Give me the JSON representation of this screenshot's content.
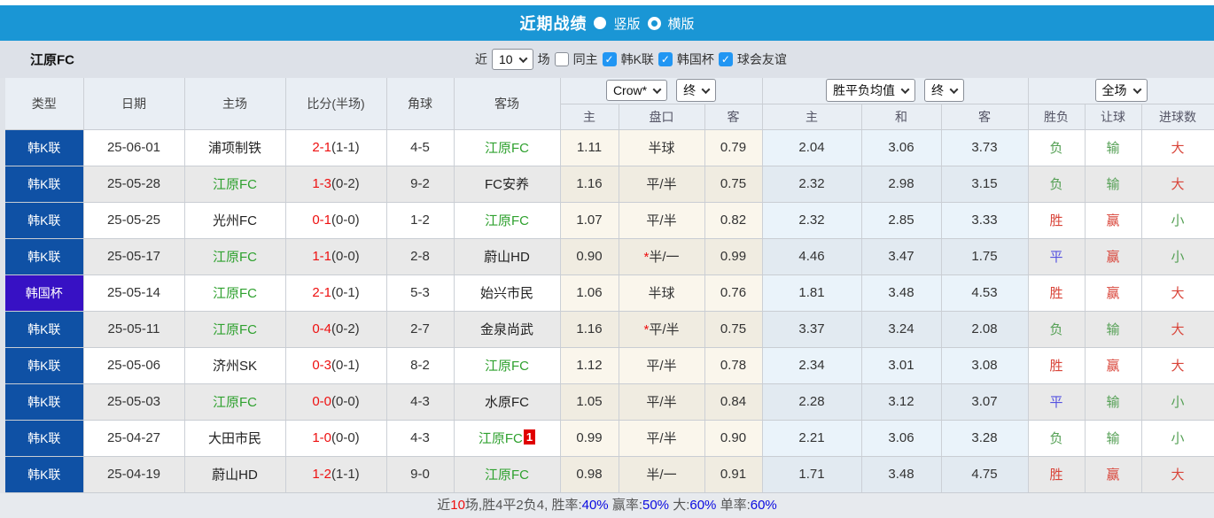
{
  "title_bar": {
    "title": "近期战绩",
    "vertical_label": "竖版",
    "horizontal_label": "横版",
    "selected_layout": "竖版"
  },
  "filter_bar": {
    "team": "江原FC",
    "near_label": "近",
    "games_count": "10",
    "games_unit": "场",
    "same_home": {
      "label": "同主",
      "checked": false
    },
    "leagues": [
      {
        "label": "韩K联",
        "checked": true
      },
      {
        "label": "韩国杯",
        "checked": true
      },
      {
        "label": "球会友谊",
        "checked": true
      }
    ]
  },
  "table": {
    "left_headers": [
      "类型",
      "日期",
      "主场",
      "比分(半场)",
      "角球",
      "客场"
    ],
    "odds_group": {
      "company": "Crow*",
      "time": "终",
      "sub": [
        "主",
        "盘口",
        "客"
      ]
    },
    "avg_group": {
      "name": "胜平负均值",
      "time": "终",
      "sub": [
        "主",
        "和",
        "客"
      ]
    },
    "result_group": {
      "scope": "全场",
      "sub": [
        "胜负",
        "让球",
        "进球数"
      ]
    },
    "rows": [
      {
        "type": "韩K联",
        "type_style": "league",
        "date": "25-06-01",
        "home": "浦项制铁",
        "home_target": false,
        "score": "2-1",
        "half": "(1-1)",
        "corner": "4-5",
        "away": "江原FC",
        "away_target": true,
        "away_redcard": "",
        "odds_home": "1.11",
        "handicap": "半球",
        "handicap_star": false,
        "odds_away": "0.79",
        "avg_home": "2.04",
        "avg_draw": "3.06",
        "avg_away": "3.73",
        "spf": "负",
        "spf_c": "green",
        "rq": "输",
        "rq_c": "green",
        "jq": "大",
        "jq_c": "red"
      },
      {
        "type": "韩K联",
        "type_style": "league",
        "date": "25-05-28",
        "home": "江原FC",
        "home_target": true,
        "score": "1-3",
        "half": "(0-2)",
        "corner": "9-2",
        "away": "FC安养",
        "away_target": false,
        "away_redcard": "",
        "odds_home": "1.16",
        "handicap": "平/半",
        "handicap_star": false,
        "odds_away": "0.75",
        "avg_home": "2.32",
        "avg_draw": "2.98",
        "avg_away": "3.15",
        "spf": "负",
        "spf_c": "green",
        "rq": "输",
        "rq_c": "green",
        "jq": "大",
        "jq_c": "red"
      },
      {
        "type": "韩K联",
        "type_style": "league",
        "date": "25-05-25",
        "home": "光州FC",
        "home_target": false,
        "score": "0-1",
        "half": "(0-0)",
        "corner": "1-2",
        "away": "江原FC",
        "away_target": true,
        "away_redcard": "",
        "odds_home": "1.07",
        "handicap": "平/半",
        "handicap_star": false,
        "odds_away": "0.82",
        "avg_home": "2.32",
        "avg_draw": "2.85",
        "avg_away": "3.33",
        "spf": "胜",
        "spf_c": "red",
        "rq": "赢",
        "rq_c": "red",
        "jq": "小",
        "jq_c": "green"
      },
      {
        "type": "韩K联",
        "type_style": "league",
        "date": "25-05-17",
        "home": "江原FC",
        "home_target": true,
        "score": "1-1",
        "half": "(0-0)",
        "corner": "2-8",
        "away": "蔚山HD",
        "away_target": false,
        "away_redcard": "",
        "odds_home": "0.90",
        "handicap": "半/一",
        "handicap_star": true,
        "odds_away": "0.99",
        "avg_home": "4.46",
        "avg_draw": "3.47",
        "avg_away": "1.75",
        "spf": "平",
        "spf_c": "blue",
        "rq": "赢",
        "rq_c": "red",
        "jq": "小",
        "jq_c": "green"
      },
      {
        "type": "韩国杯",
        "type_style": "cup",
        "date": "25-05-14",
        "home": "江原FC",
        "home_target": true,
        "score": "2-1",
        "half": "(0-1)",
        "corner": "5-3",
        "away": "始兴市民",
        "away_target": false,
        "away_redcard": "",
        "odds_home": "1.06",
        "handicap": "半球",
        "handicap_star": false,
        "odds_away": "0.76",
        "avg_home": "1.81",
        "avg_draw": "3.48",
        "avg_away": "4.53",
        "spf": "胜",
        "spf_c": "red",
        "rq": "赢",
        "rq_c": "red",
        "jq": "大",
        "jq_c": "red"
      },
      {
        "type": "韩K联",
        "type_style": "league",
        "date": "25-05-11",
        "home": "江原FC",
        "home_target": true,
        "score": "0-4",
        "half": "(0-2)",
        "corner": "2-7",
        "away": "金泉尚武",
        "away_target": false,
        "away_redcard": "",
        "odds_home": "1.16",
        "handicap": "平/半",
        "handicap_star": true,
        "odds_away": "0.75",
        "avg_home": "3.37",
        "avg_draw": "3.24",
        "avg_away": "2.08",
        "spf": "负",
        "spf_c": "green",
        "rq": "输",
        "rq_c": "green",
        "jq": "大",
        "jq_c": "red"
      },
      {
        "type": "韩K联",
        "type_style": "league",
        "date": "25-05-06",
        "home": "济州SK",
        "home_target": false,
        "score": "0-3",
        "half": "(0-1)",
        "corner": "8-2",
        "away": "江原FC",
        "away_target": true,
        "away_redcard": "",
        "odds_home": "1.12",
        "handicap": "平/半",
        "handicap_star": false,
        "odds_away": "0.78",
        "avg_home": "2.34",
        "avg_draw": "3.01",
        "avg_away": "3.08",
        "spf": "胜",
        "spf_c": "red",
        "rq": "赢",
        "rq_c": "red",
        "jq": "大",
        "jq_c": "red"
      },
      {
        "type": "韩K联",
        "type_style": "league",
        "date": "25-05-03",
        "home": "江原FC",
        "home_target": true,
        "score": "0-0",
        "half": "(0-0)",
        "corner": "4-3",
        "away": "水原FC",
        "away_target": false,
        "away_redcard": "",
        "odds_home": "1.05",
        "handicap": "平/半",
        "handicap_star": false,
        "odds_away": "0.84",
        "avg_home": "2.28",
        "avg_draw": "3.12",
        "avg_away": "3.07",
        "spf": "平",
        "spf_c": "blue",
        "rq": "输",
        "rq_c": "green",
        "jq": "小",
        "jq_c": "green"
      },
      {
        "type": "韩K联",
        "type_style": "league",
        "date": "25-04-27",
        "home": "大田市民",
        "home_target": false,
        "score": "1-0",
        "half": "(0-0)",
        "corner": "4-3",
        "away": "江原FC",
        "away_target": true,
        "away_redcard": "1",
        "odds_home": "0.99",
        "handicap": "平/半",
        "handicap_star": false,
        "odds_away": "0.90",
        "avg_home": "2.21",
        "avg_draw": "3.06",
        "avg_away": "3.28",
        "spf": "负",
        "spf_c": "green",
        "rq": "输",
        "rq_c": "green",
        "jq": "小",
        "jq_c": "green"
      },
      {
        "type": "韩K联",
        "type_style": "league",
        "date": "25-04-19",
        "home": "蔚山HD",
        "home_target": false,
        "score": "1-2",
        "half": "(1-1)",
        "corner": "9-0",
        "away": "江原FC",
        "away_target": true,
        "away_redcard": "",
        "odds_home": "0.98",
        "handicap": "半/一",
        "handicap_star": false,
        "odds_away": "0.91",
        "avg_home": "1.71",
        "avg_draw": "3.48",
        "avg_away": "4.75",
        "spf": "胜",
        "spf_c": "red",
        "rq": "赢",
        "rq_c": "red",
        "jq": "大",
        "jq_c": "red"
      }
    ]
  },
  "summary": {
    "segments": [
      {
        "text": "近",
        "color": "gray"
      },
      {
        "text": "10",
        "color": "red"
      },
      {
        "text": "场,胜4平2负4, 胜率:",
        "color": "gray"
      },
      {
        "text": "40%",
        "color": "blue"
      },
      {
        "text": " 赢率:",
        "color": "gray"
      },
      {
        "text": "50%",
        "color": "blue"
      },
      {
        "text": " 大:",
        "color": "gray"
      },
      {
        "text": "60%",
        "color": "blue"
      },
      {
        "text": " 单率:",
        "color": "gray"
      },
      {
        "text": "60%",
        "color": "blue"
      }
    ]
  },
  "colors": {
    "title_bar_blue": "#1a96d5",
    "league_badge_blue": "#0f51a5",
    "cup_badge_purple": "#3711c4",
    "target_team_green": "#2fa12f",
    "score_red": "#ee1010",
    "result_red": "#d9453a",
    "result_green": "#55a055",
    "result_draw_blue": "#5552e0",
    "summary_link_blue": "#0a0ae0",
    "checkbox_blue": "#2196f3"
  }
}
